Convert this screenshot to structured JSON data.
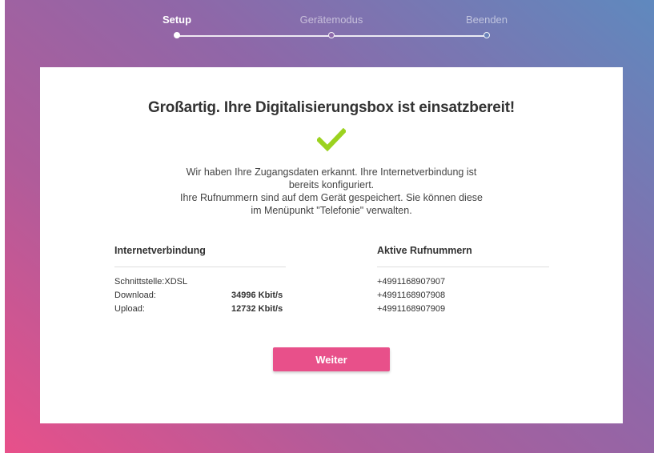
{
  "steps": [
    {
      "label": "Setup",
      "state": "active"
    },
    {
      "label": "Gerätemodus",
      "state": "inactive"
    },
    {
      "label": "Beenden",
      "state": "inactive"
    }
  ],
  "card": {
    "title": "Großartig. Ihre Digitalisierungsbox ist einsatzbereit!",
    "success_icon": "checkmark-icon",
    "message_line1": "Wir haben Ihre Zugangsdaten erkannt. Ihre Internetverbindung ist",
    "message_line2": "bereits konfiguriert.",
    "message_line3": "Ihre Rufnummern sind auf dem Gerät gespeichert. Sie können diese",
    "message_line4": "im Menüpunkt \"Telefonie\" verwalten."
  },
  "internet": {
    "heading": "Internetverbindung",
    "interface": "Schnittstelle:XDSL",
    "download_label": "Download:",
    "download_value": "34996 Kbit/s",
    "upload_label": "Upload:",
    "upload_value": "12732 Kbit/s"
  },
  "numbers": {
    "heading": "Aktive Rufnummern",
    "items": [
      "+4991168907907",
      "+4991168907908",
      "+4991168907909"
    ]
  },
  "actions": {
    "next_label": "Weiter"
  },
  "colors": {
    "accent": "#e8508a",
    "check": "#9bd21f"
  }
}
